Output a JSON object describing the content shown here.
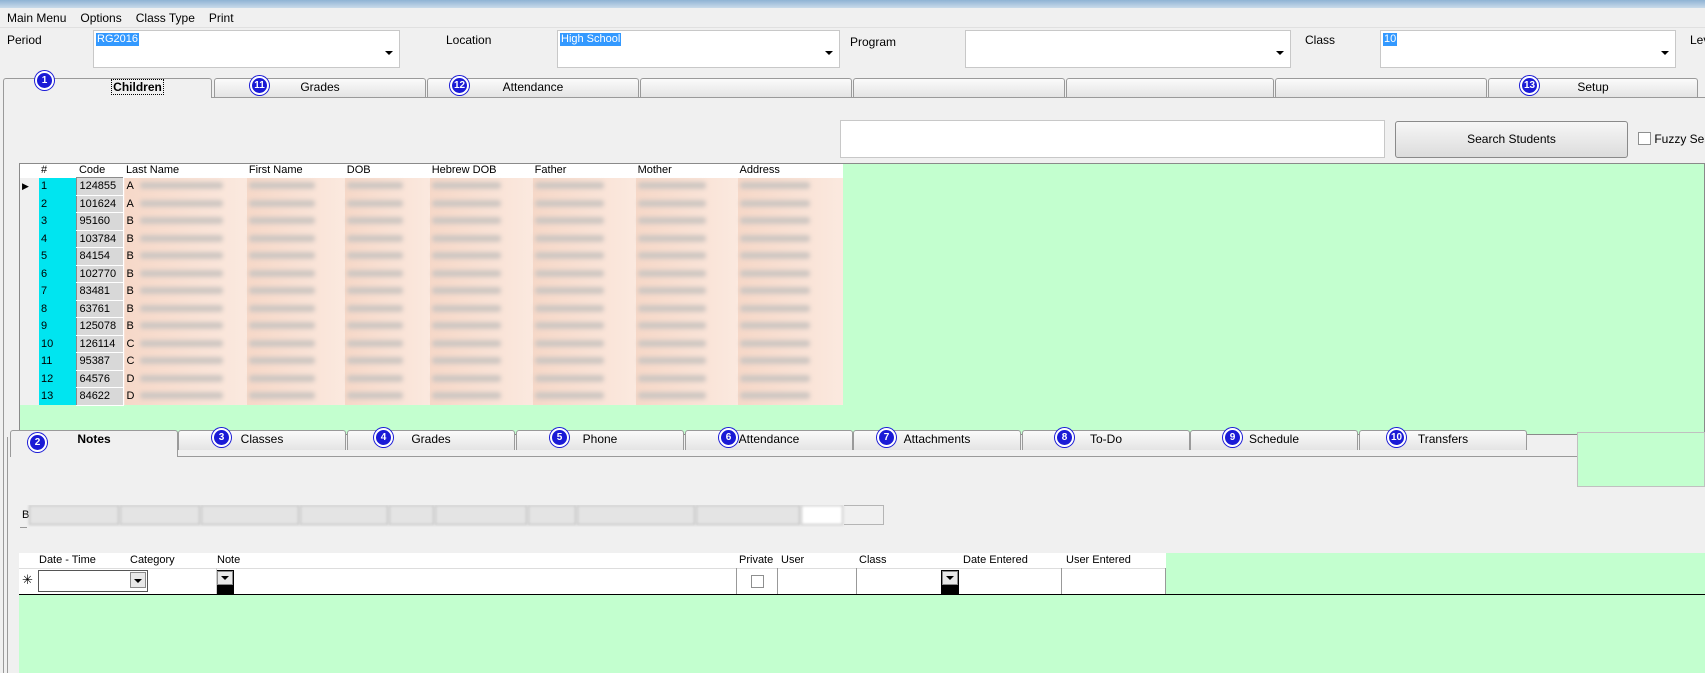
{
  "menu": [
    "Main Menu",
    "Options",
    "Class Type",
    "Print"
  ],
  "filters": {
    "period_label": "Period",
    "period_value": "RG2016",
    "location_label": "Location",
    "location_value": "High School",
    "program_label": "Program",
    "program_value": "",
    "class_label": "Class",
    "class_value": "10",
    "level_label": "Lev"
  },
  "top_tabs": [
    {
      "label": "Children",
      "badge": "1"
    },
    {
      "label": "Grades",
      "badge": "11"
    },
    {
      "label": "Attendance",
      "badge": "12"
    },
    {
      "label": ""
    },
    {
      "label": ""
    },
    {
      "label": ""
    },
    {
      "label": ""
    },
    {
      "label": "Setup",
      "badge": "13"
    }
  ],
  "search": {
    "button_label": "Search Students",
    "fuzzy_label": "Fuzzy Sea"
  },
  "students": {
    "columns": [
      "#",
      "Code",
      "Last Name",
      "First Name",
      "DOB",
      "Hebrew DOB",
      "Father",
      "Mother",
      "Address"
    ],
    "rows": [
      {
        "num": "1",
        "code": "124855",
        "initial": "A"
      },
      {
        "num": "2",
        "code": "101624",
        "initial": "A"
      },
      {
        "num": "3",
        "code": "95160",
        "initial": "B"
      },
      {
        "num": "4",
        "code": "103784",
        "initial": "B"
      },
      {
        "num": "5",
        "code": "84154",
        "initial": "B"
      },
      {
        "num": "6",
        "code": "102770",
        "initial": "B"
      },
      {
        "num": "7",
        "code": "83481",
        "initial": "B"
      },
      {
        "num": "8",
        "code": "63761",
        "initial": "B"
      },
      {
        "num": "9",
        "code": "125078",
        "initial": "B"
      },
      {
        "num": "10",
        "code": "126114",
        "initial": "C"
      },
      {
        "num": "11",
        "code": "95387",
        "initial": "C"
      },
      {
        "num": "12",
        "code": "64576",
        "initial": "D"
      },
      {
        "num": "13",
        "code": "84622",
        "initial": "D"
      }
    ]
  },
  "bottom_tabs": [
    {
      "label": "Notes",
      "badge": "2"
    },
    {
      "label": "Classes",
      "badge": "3"
    },
    {
      "label": "Grades",
      "badge": "4"
    },
    {
      "label": "Phone",
      "badge": "5"
    },
    {
      "label": "Attendance",
      "badge": "6"
    },
    {
      "label": "Attachments",
      "badge": "7"
    },
    {
      "label": "To-Do",
      "badge": "8"
    },
    {
      "label": "Schedule",
      "badge": "9"
    },
    {
      "label": "Transfers",
      "badge": "10"
    }
  ],
  "notes": {
    "columns": [
      "Date - Time",
      "Category",
      "Note",
      "Private",
      "User",
      "Class",
      "Date Entered",
      "User Entered"
    ],
    "new_row_marker": "✳",
    "subtab_first_initial": "B"
  },
  "colors": {
    "grid_background": "#c3ffcf",
    "row_number": "#00e5f0",
    "badge": "#1a1ad6"
  }
}
